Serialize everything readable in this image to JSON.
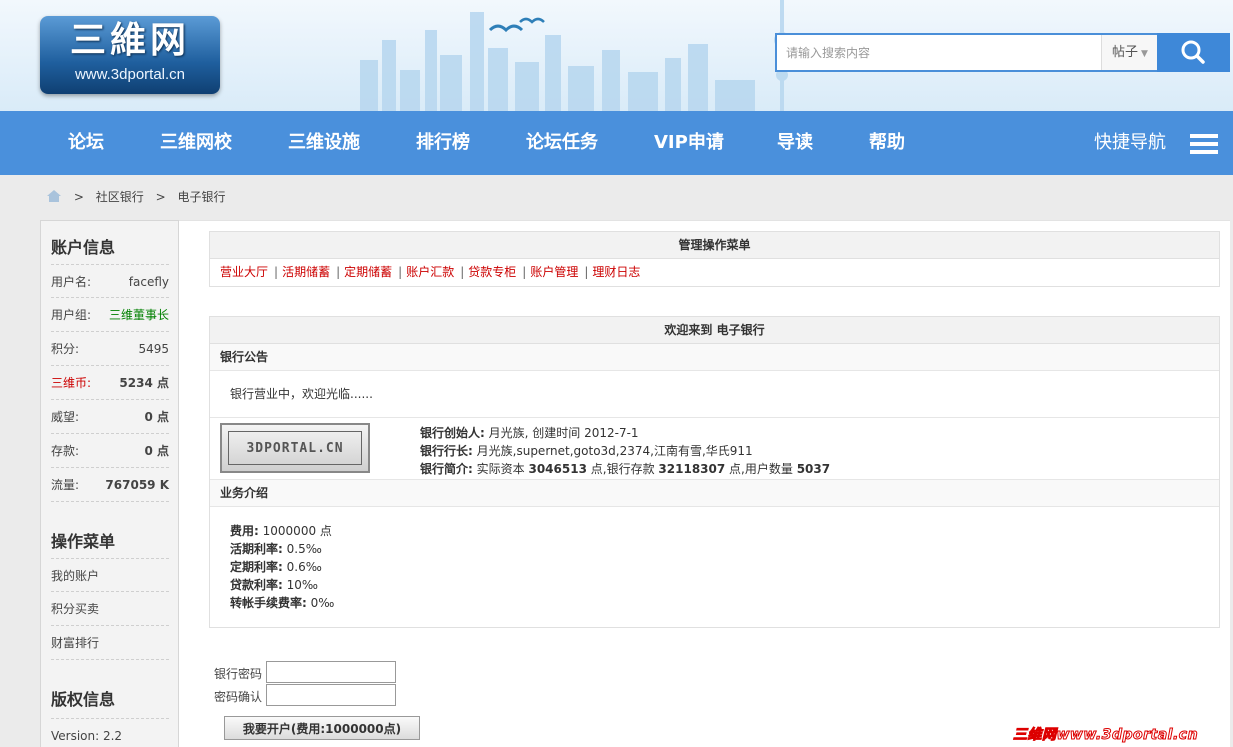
{
  "header": {
    "logo_title": "三維网",
    "logo_url": "www.3dportal.cn",
    "search_placeholder": "请输入搜索内容",
    "search_scope": "帖子"
  },
  "nav": {
    "items": [
      "论坛",
      "三维网校",
      "三维设施",
      "排行榜",
      "论坛任务",
      "VIP申请",
      "导读",
      "帮助"
    ],
    "quick_nav": "快捷导航"
  },
  "breadcrumb": {
    "items": [
      "社区银行",
      "电子银行"
    ],
    "separator": ">"
  },
  "sidebar": {
    "account_title": "账户信息",
    "account": [
      {
        "label": "用户名:",
        "value": "facefly"
      },
      {
        "label": "用户组:",
        "value": "三维董事长"
      },
      {
        "label": "积分:",
        "value": "5495"
      },
      {
        "label": "三维币:",
        "value": "5234 点"
      },
      {
        "label": "威望:",
        "value": "0 点"
      },
      {
        "label": "存款:",
        "value": "0 点"
      },
      {
        "label": "流量:",
        "value": "767059 K"
      }
    ],
    "menu_title": "操作菜单",
    "menu": [
      "我的账户",
      "积分买卖",
      "财富排行"
    ],
    "copyright_title": "版权信息",
    "version": "Version: 2.2"
  },
  "admin_menu": {
    "title": "管理操作菜单",
    "links": [
      "营业大厅",
      "活期储蓄",
      "定期储蓄",
      "账户汇款",
      "贷款专柜",
      "账户管理",
      "理财日志"
    ]
  },
  "bank": {
    "welcome": "欢迎来到 电子银行",
    "notice_title": "银行公告",
    "notice_text": "银行营业中，欢迎光临......",
    "logo_text": "3DPORTAL.CN",
    "founder_label": "银行创始人:",
    "founder_value": "月光族, 创建时间 2012-7-1",
    "president_label": "银行行长:",
    "president_value": "月光族,supernet,goto3d,2374,江南有雪,华氏911",
    "intro_label": "银行简介:",
    "intro_capital_prefix": "实际资本",
    "intro_capital": "3046513",
    "intro_deposit_prefix": "点,银行存款",
    "intro_deposit": "32118307",
    "intro_users_prefix": "点,用户数量",
    "intro_users": "5037",
    "business_title": "业务介绍",
    "business": [
      {
        "label": "费用:",
        "value": "1000000 点"
      },
      {
        "label": "活期利率:",
        "value": "0.5‰"
      },
      {
        "label": "定期利率:",
        "value": "0.6‰"
      },
      {
        "label": "贷款利率:",
        "value": "10‰"
      },
      {
        "label": "转帐手续费率:",
        "value": "0‰"
      }
    ]
  },
  "form": {
    "password_label": "银行密码",
    "confirm_label": "密码确认",
    "submit_label": "我要开户(费用:1000000点)"
  },
  "watermark": "三维网www.3dportal.cn",
  "colors": {
    "nav_bg": "#4a90dc",
    "link_red": "#cc0000",
    "group_green": "#008000"
  }
}
